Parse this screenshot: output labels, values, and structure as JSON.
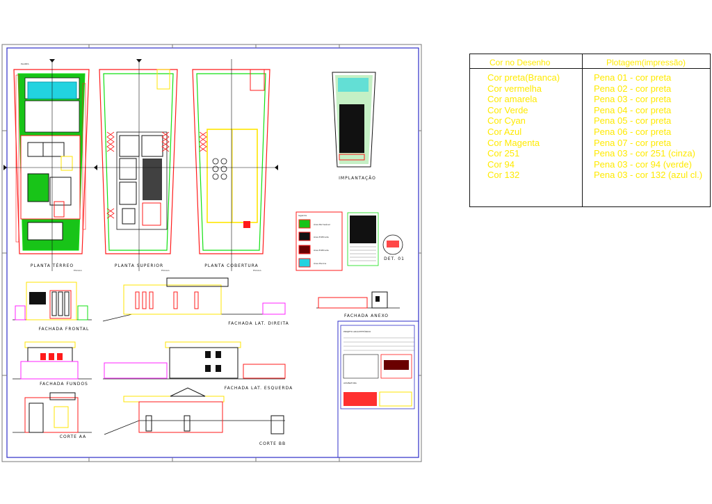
{
  "drawing": {
    "titles": {
      "planta_terreo": "PLANTA TÉRREO",
      "planta_superior": "PLANTA SUPERIOR",
      "planta_cobertura": "PLANTA COBERTURA",
      "implantacao": "IMPLANTAÇÃO",
      "fachada_frontal": "FACHADA FRONTAL",
      "fachada_lat_direita": "FACHADA LAT. DIREITA",
      "fachada_anexo": "FACHADA ANEXO",
      "fachada_fundos": "FACHADA FUNDOS",
      "fachada_lat_esquerda": "FACHADA LAT. ESQUERDA",
      "corte_aa": "CORTE AA",
      "corte_bb": "CORTE BB",
      "det_01": "DET. 01"
    },
    "legend": {
      "title": "legenda",
      "items": [
        {
          "label": "Área Permeável",
          "color": "#18c418"
        },
        {
          "label": "Área Edificada",
          "color": "#111111"
        },
        {
          "label": "Área Edificada",
          "color": "#6a0000"
        },
        {
          "label": "Área Piscina",
          "color": "#22d3e0"
        }
      ]
    },
    "title_block": {
      "heading": "PROJETO ARQUITETÔNICO"
    },
    "colors": {
      "red": "#ff1a1a",
      "green": "#10e010",
      "yellow": "#ffe600",
      "cyan": "#19e3ef",
      "magenta": "#ff22ff",
      "blue": "#2222ff",
      "frame": "#2d2dc8"
    }
  },
  "pen_table": {
    "col1_header": "Cor no Desenho",
    "col2_header": "Plotagem(impressão)",
    "rows": [
      {
        "cor": "Cor preta(Branca)",
        "pena": "Pena 01 - cor preta"
      },
      {
        "cor": "Cor vermelha",
        "pena": "Pena 02 - cor preta"
      },
      {
        "cor": "Cor amarela",
        "pena": "Pena 03 - cor preta"
      },
      {
        "cor": "Cor Verde",
        "pena": "Pena 04 - cor preta"
      },
      {
        "cor": "Cor Cyan",
        "pena": "Pena 05 - cor preta"
      },
      {
        "cor": "Cor Azul",
        "pena": "Pena 06 - cor preta"
      },
      {
        "cor": "Cor Magenta",
        "pena": "Pena 07 - cor preta"
      },
      {
        "cor": "Cor 251",
        "pena": "Pena 03 - cor 251 (cinza)"
      },
      {
        "cor": "Cor 94",
        "pena": "Pena 03 - cor 94 (verde)"
      },
      {
        "cor": "Cor 132",
        "pena": "Pena 03 - cor 132 (azul cl.)"
      }
    ]
  }
}
